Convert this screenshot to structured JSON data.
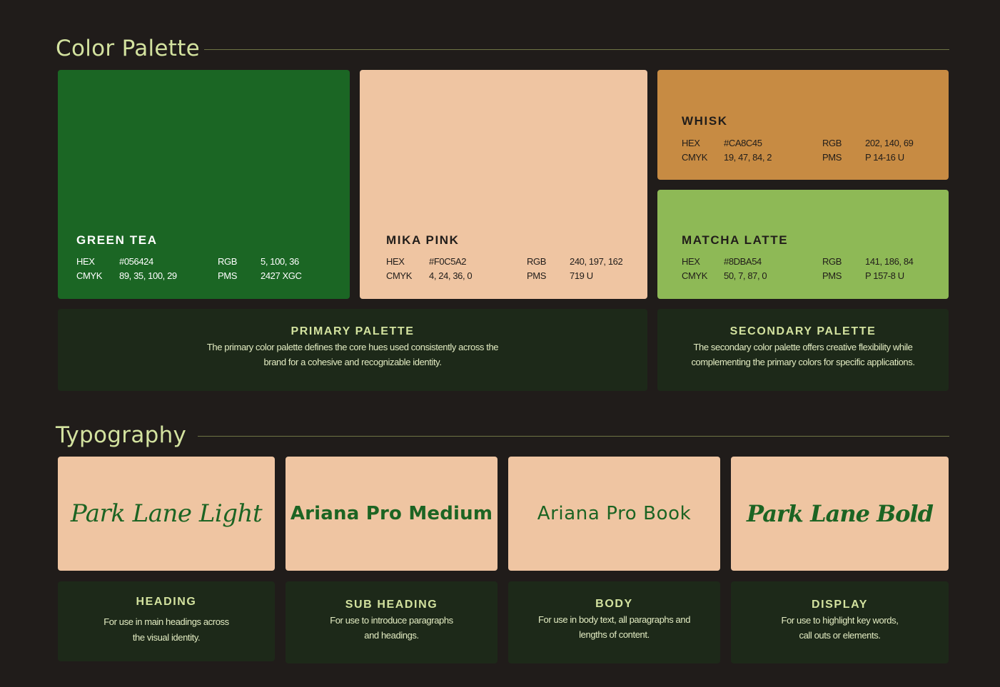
{
  "color_section": {
    "title": "Color Palette",
    "swatches": [
      {
        "id": "green-tea",
        "name": "GREEN TEA",
        "color": "#1b6624",
        "text_color": "#ffffff",
        "hex_label": "HEX",
        "hex": "#056424",
        "rgb_label": "RGB",
        "rgb": "5, 100, 36",
        "cmyk_label": "CMYK",
        "cmyk": "89, 35, 100, 29",
        "pms_label": "PMS",
        "pms": "2427 XGC"
      },
      {
        "id": "mika-pink",
        "name": "MIKA PINK",
        "color": "#efc5a2",
        "text_color": "#211d1a",
        "hex_label": "HEX",
        "hex": "#F0C5A2",
        "rgb_label": "RGB",
        "rgb": "240, 197, 162",
        "cmyk_label": "CMYK",
        "cmyk": "4, 24, 36, 0",
        "pms_label": "PMS",
        "pms": "719 U"
      },
      {
        "id": "whisk",
        "name": "WHISK",
        "color": "#c78b43",
        "text_color": "#211d1a",
        "hex_label": "HEX",
        "hex": "#CA8C45",
        "rgb_label": "RGB",
        "rgb": "202, 140, 69",
        "cmyk_label": "CMYK",
        "cmyk": "19, 47, 84, 2",
        "pms_label": "PMS",
        "pms": "P 14-16 U"
      },
      {
        "id": "matcha-latte",
        "name": "MATCHA LATTE",
        "color": "#8eb956",
        "text_color": "#211d1a",
        "hex_label": "HEX",
        "hex": "#8DBA54",
        "rgb_label": "RGB",
        "rgb": "141, 186, 84",
        "cmyk_label": "CMYK",
        "cmyk": "50, 7, 87, 0",
        "pms_label": "PMS",
        "pms": "P 157-8 U"
      }
    ],
    "primary": {
      "title": "PRIMARY PALETTE",
      "line1": "The primary color palette defines the core hues used consistently across the",
      "line2": "brand for a cohesive and recognizable identity."
    },
    "secondary": {
      "title": "SECONDARY PALETTE",
      "line1": "The secondary color palette offers creative flexibility while",
      "line2": "complementing the primary colors for specific applications."
    }
  },
  "typography_section": {
    "title": "Typography",
    "fonts": [
      {
        "sample": "Park Lane Light",
        "title": "HEADING",
        "line1": "For use in main headings across",
        "line2": "the visual identity."
      },
      {
        "sample": "Ariana Pro Medium",
        "title": "SUB HEADING",
        "line1": "For use to introduce paragraphs",
        "line2": "and headings."
      },
      {
        "sample": "Ariana Pro Book",
        "title": "BODY",
        "line1": "For use in body text, all paragraphs and",
        "line2": "lengths of content."
      },
      {
        "sample": "Park Lane Bold",
        "title": "DISPLAY",
        "line1": "For use to highlight key words,",
        "line2": "call outs or elements."
      }
    ]
  },
  "colors": {
    "background": "#201c1a",
    "section_title": "#d3e29f",
    "description_card": "#1d2919",
    "type_sample": "#1c6423"
  }
}
